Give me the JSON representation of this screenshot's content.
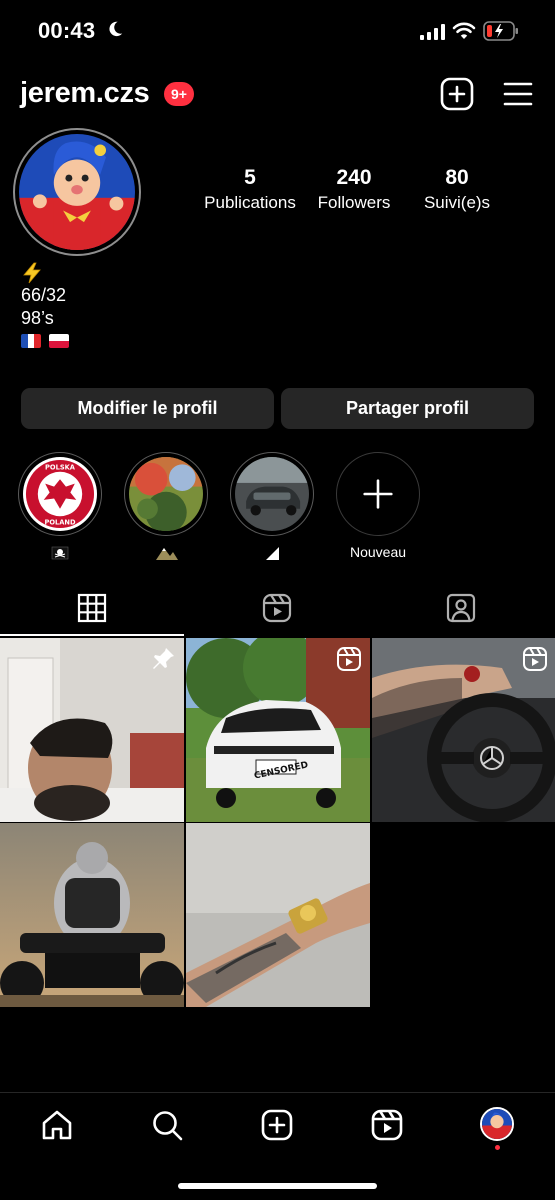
{
  "status_bar": {
    "time": "00:43",
    "icons": [
      "moon-icon",
      "signal-icon",
      "wifi-icon",
      "battery-low-charging-icon"
    ]
  },
  "header": {
    "username": "jerem.czs",
    "notification_badge": "9+",
    "icons": [
      "add-post-icon",
      "menu-icon"
    ]
  },
  "stats": [
    {
      "value": "5",
      "label": "Publications"
    },
    {
      "value": "240",
      "label": "Followers"
    },
    {
      "value": "80",
      "label": "Suivi(e)s"
    }
  ],
  "bio": {
    "line1_icon": "lightning-emoji",
    "line2": "66/32",
    "line3": "98’s",
    "flags": [
      "flag-france",
      "flag-poland"
    ]
  },
  "buttons": {
    "edit_profile": "Modifier le profil",
    "share_profile": "Partager profil"
  },
  "highlights": [
    {
      "label": "",
      "label_icon": "pirate-flag-emoji",
      "thumb": "polska-poland-emblem"
    },
    {
      "label": "",
      "label_icon": "mountain-emoji",
      "thumb": "nature-photo"
    },
    {
      "label": "",
      "label_icon": "triangle-symbol",
      "thumb": "car-photo"
    },
    {
      "label": "Nouveau",
      "label_icon": "plus-icon",
      "thumb": "new-highlight"
    }
  ],
  "tabs": [
    "grid-icon",
    "reels-icon",
    "tagged-icon"
  ],
  "posts": [
    {
      "type": "photo",
      "pinned": true,
      "subject": "man-sleeping"
    },
    {
      "type": "reel",
      "pinned": false,
      "subject": "white-suv",
      "overlay_text": "CENSORED"
    },
    {
      "type": "reel",
      "pinned": false,
      "subject": "steering-wheel"
    },
    {
      "type": "photo",
      "pinned": false,
      "subject": "atv-rider"
    },
    {
      "type": "photo",
      "pinned": false,
      "subject": "tattooed-arm-watch"
    }
  ],
  "bottom_nav": [
    "home-icon",
    "search-icon",
    "create-icon",
    "reels-icon",
    "profile-avatar"
  ],
  "colors": {
    "background": "#000000",
    "button_bg": "#262626",
    "badge_red": "#ff3040",
    "text": "#ffffff"
  }
}
